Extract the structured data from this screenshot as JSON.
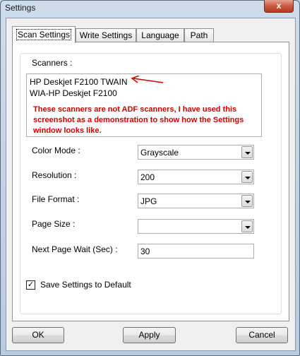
{
  "window": {
    "title": "Settings",
    "close_glyph": "x"
  },
  "tabs": [
    {
      "label": "Scan Settings",
      "active": true
    },
    {
      "label": "Write Settings",
      "active": false
    },
    {
      "label": "Language",
      "active": false
    },
    {
      "label": "Path",
      "active": false
    }
  ],
  "scanners": {
    "label": "Scanners :",
    "items": [
      "HP Deskjet F2100 TWAIN",
      "WIA-HP Deskjet F2100"
    ],
    "annotation": "These scanners are not ADF scanners, I have used this screenshot as a demonstration to show how the Settings window looks like.",
    "annotation_color": "#d00000"
  },
  "fields": {
    "color_mode": {
      "label": "Color Mode :",
      "value": "Grayscale"
    },
    "resolution": {
      "label": "Resolution :",
      "value": "200"
    },
    "file_format": {
      "label": "File Format :",
      "value": "JPG"
    },
    "page_size": {
      "label": "Page Size :",
      "value": ""
    },
    "next_page_wait": {
      "label": "Next Page Wait (Sec) :",
      "value": "30"
    }
  },
  "save_default": {
    "label": "Save Settings to Default",
    "checked": true,
    "check_glyph": "✓"
  },
  "buttons": {
    "ok": "OK",
    "apply": "Apply",
    "cancel": "Cancel"
  }
}
